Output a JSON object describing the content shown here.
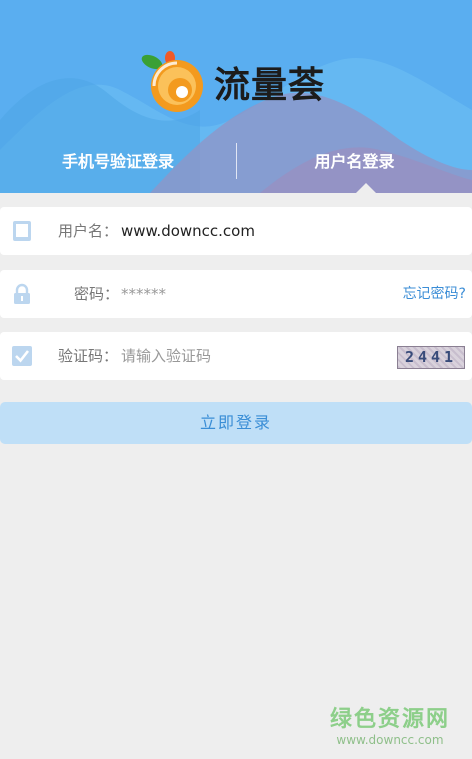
{
  "app": {
    "name": "流量荟"
  },
  "tabs": [
    {
      "label": "手机号验证登录",
      "active": false
    },
    {
      "label": "用户名登录",
      "active": true
    }
  ],
  "form": {
    "username": {
      "label": "用户名：",
      "value": "www.downcc.com",
      "icon": "phone-icon"
    },
    "password": {
      "label": "密码：",
      "value": "******",
      "icon": "lock-icon",
      "forgot_label": "忘记密码?"
    },
    "captcha": {
      "label": "验证码：",
      "placeholder": "请输入验证码",
      "icon": "checkbox-icon",
      "code": "2441"
    },
    "submit_label": "立即登录"
  },
  "watermark": {
    "text": "绿色资源网",
    "url": "www.downcc.com"
  },
  "colors": {
    "header": "#5aaef0",
    "accent": "#3a8ed6",
    "button_bg": "#bfdff7",
    "page_bg": "#eeeeee"
  }
}
